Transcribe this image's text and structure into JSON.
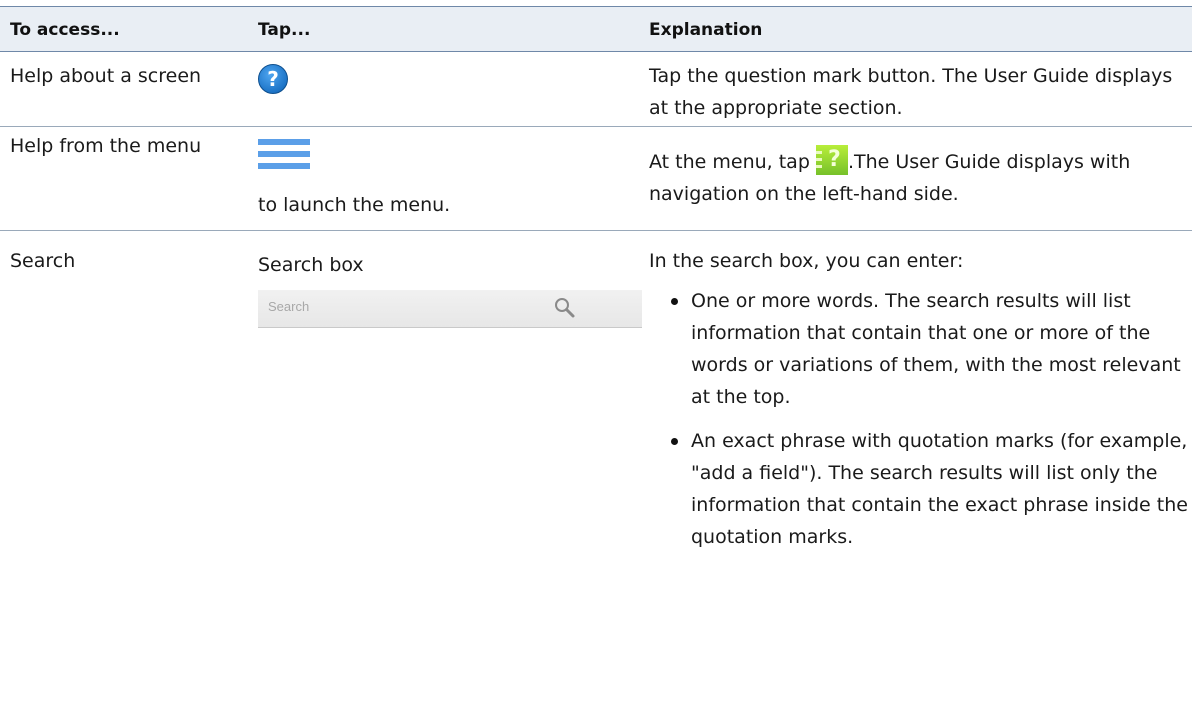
{
  "header": {
    "col1": "To access...",
    "col2": "Tap...",
    "col3": "Explanation"
  },
  "rows": [
    {
      "access": "Help about a screen",
      "tap_icon": "question-mark-icon",
      "explanation": "Tap the question mark button. The User Guide displays at the appropriate section."
    },
    {
      "access": "Help from the menu",
      "tap_icon": "menu-icon",
      "tap_text": "to launch the menu.",
      "explanation_before": "At the menu, tap",
      "explanation_icon": "help-book-icon",
      "explanation_after": ".The User Guide displays with navigation on the left-hand side."
    },
    {
      "access": "Search",
      "tap_text": "Search box",
      "search_placeholder": "Search",
      "tap_icon": "search-icon",
      "explanation_intro": "In the search box, you can enter:",
      "bullets": [
        "One or more words. The search results will list information that contain that one or more of the words or variations of them, with the most relevant at the top.",
        "An exact phrase with quotation marks (for example, \"add a field\"). The search results will list only the information that contain the exact phrase inside the quotation marks."
      ]
    }
  ],
  "colors": {
    "header_bg": "#e9eef4",
    "rule": "#6f88a8",
    "question_icon": "#1d74c7",
    "menu_icon": "#5b9fe8",
    "help_icon": "#8fd42e"
  }
}
